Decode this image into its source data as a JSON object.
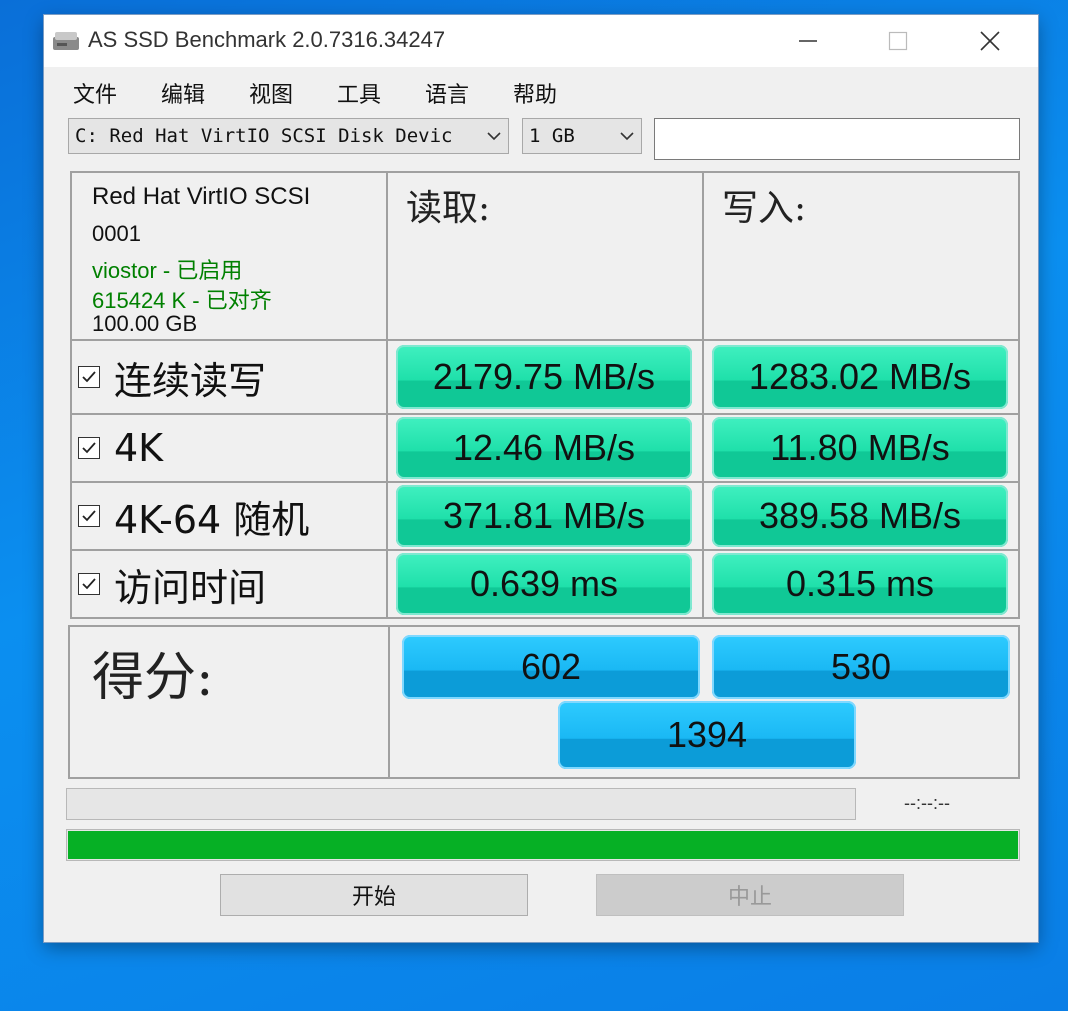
{
  "window": {
    "title": "AS SSD Benchmark 2.0.7316.34247"
  },
  "menu": [
    "文件",
    "编辑",
    "视图",
    "工具",
    "语言",
    "帮助"
  ],
  "toolbar": {
    "drive_select": "C: Red Hat VirtIO SCSI Disk Devic",
    "size_select": "1 GB",
    "extra_field": ""
  },
  "device_info": {
    "name": "Red Hat VirtIO SCSI",
    "revision": "0001",
    "driver": "viostor - 已启用",
    "alignment": "615424 K - 已对齐",
    "capacity": "100.00 GB"
  },
  "headers": {
    "read": "读取:",
    "write": "写入:"
  },
  "rows": [
    {
      "label": "连续读写",
      "checked": true,
      "read": "2179.75 MB/s",
      "write": "1283.02 MB/s"
    },
    {
      "label": "4K",
      "checked": true,
      "read": "12.46 MB/s",
      "write": "11.80 MB/s"
    },
    {
      "label": "4K-64 随机",
      "checked": true,
      "read": "371.81 MB/s",
      "write": "389.58 MB/s"
    },
    {
      "label": "访问时间",
      "checked": true,
      "read": "0.639 ms",
      "write": "0.315 ms"
    }
  ],
  "score": {
    "label": "得分:",
    "read": "602",
    "write": "530",
    "total": "1394"
  },
  "status": {
    "elapsed": "--:--:--",
    "test_progress": 0,
    "overall_progress": 1.0
  },
  "buttons": {
    "start": "开始",
    "stop": "中止"
  },
  "colors": {
    "result_green": "#1fe0aa",
    "score_blue": "#1ab8f4",
    "progress_green": "#06b025",
    "driver_text": "#008000"
  }
}
